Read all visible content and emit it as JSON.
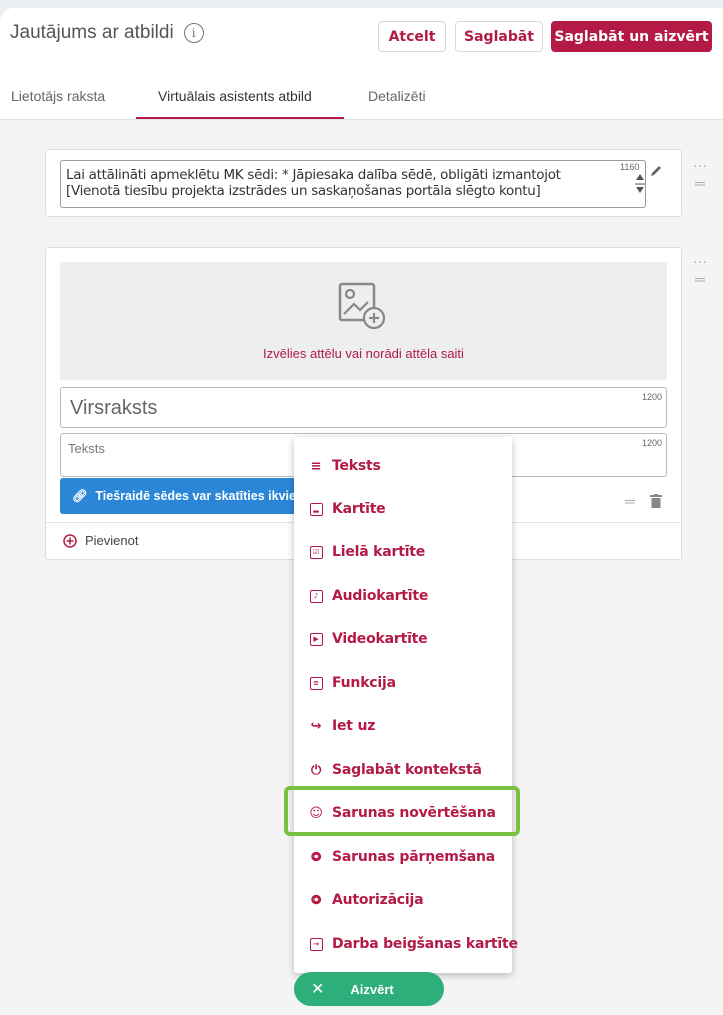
{
  "header": {
    "title": "Jautājums ar atbildi",
    "info_icon": "i",
    "cancel_label": "Atcelt",
    "save_label": "Saglabāt",
    "save_close_label": "Saglabāt un aizvērt"
  },
  "tabs": [
    {
      "label": "Lietotājs raksta"
    },
    {
      "label": "Virtuālais asistents atbild"
    },
    {
      "label": "Detalizēti"
    }
  ],
  "text_card": {
    "content": "Lai attālināti apmeklētu MK sēdi: * Jāpiesaka dalība sēdē, obligāti izmantojot [Vienotā tiesību projekta  izstrādes un saskaņošanas portāla slēgto kontu]",
    "counter": "1160"
  },
  "media_card": {
    "image_caption": "Izvēlies attēlu vai norādi attēla saiti",
    "title_placeholder": "Virsraksts",
    "title_counter": "1200",
    "text_placeholder": "Teksts",
    "text_counter": "1200",
    "link_label": "Tiešraidē sēdes var skatīties ikvie",
    "add_label": "Pievienot"
  },
  "menu": {
    "items": [
      {
        "label": "Teksts",
        "icon": "text-lines-icon"
      },
      {
        "label": "Kartīte",
        "icon": "card-icon"
      },
      {
        "label": "Lielā kartīte",
        "icon": "large-card-icon"
      },
      {
        "label": "Audiokartīte",
        "icon": "audio-card-icon"
      },
      {
        "label": "Videokartīte",
        "icon": "video-card-icon"
      },
      {
        "label": "Funkcija",
        "icon": "function-icon"
      },
      {
        "label": "Iet uz",
        "icon": "go-to-icon"
      },
      {
        "label": "Saglabāt kontekstā",
        "icon": "save-context-icon"
      },
      {
        "label": "Sarunas novērtēšana",
        "icon": "smiley-icon"
      },
      {
        "label": "Sarunas pārņemšana",
        "icon": "handover-icon"
      },
      {
        "label": "Autorizācija",
        "icon": "authorization-icon"
      },
      {
        "label": "Darba beigšanas kartīte",
        "icon": "exit-card-icon"
      }
    ]
  },
  "close_button": {
    "label": "Aizvērt",
    "icon": "close-icon"
  },
  "colors": {
    "accent": "#b31a45",
    "link_blue": "#2b86d8",
    "close_green": "#2eae7a",
    "highlight_green": "#7ac142"
  }
}
